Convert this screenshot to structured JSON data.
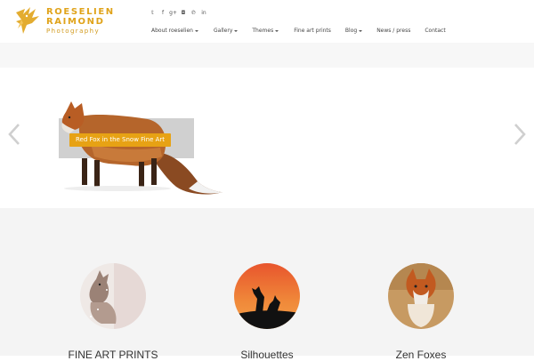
{
  "logo": {
    "line1": "ROESELIEN",
    "line2": "RAIMOND",
    "line3": "Photography"
  },
  "social": [
    {
      "icon": "twitter-icon",
      "glyph": "𝕥"
    },
    {
      "icon": "facebook-icon",
      "glyph": "f"
    },
    {
      "icon": "google-plus-icon",
      "glyph": "g+"
    },
    {
      "icon": "instagram-icon",
      "glyph": "◘"
    },
    {
      "icon": "pinterest-icon",
      "glyph": "℗"
    },
    {
      "icon": "linkedin-icon",
      "glyph": "in"
    }
  ],
  "nav": [
    {
      "label": "About roeselien",
      "dropdown": true
    },
    {
      "label": "Gallery",
      "dropdown": true
    },
    {
      "label": "Themes",
      "dropdown": true
    },
    {
      "label": "Fine art prints",
      "dropdown": false
    },
    {
      "label": "Blog",
      "dropdown": true
    },
    {
      "label": "News / press",
      "dropdown": false
    },
    {
      "label": "Contact",
      "dropdown": false
    }
  ],
  "slider": {
    "caption": "Red Fox in the Snow Fine Art"
  },
  "cards": [
    {
      "title": "FINE ART PRINTS"
    },
    {
      "title": "Silhouettes"
    },
    {
      "title": "Zen Foxes"
    }
  ],
  "colors": {
    "accent": "#e7a214",
    "logo": "#e0a31a",
    "lower_bg": "#f4f4f4",
    "band_bg": "#f7f7f7"
  }
}
